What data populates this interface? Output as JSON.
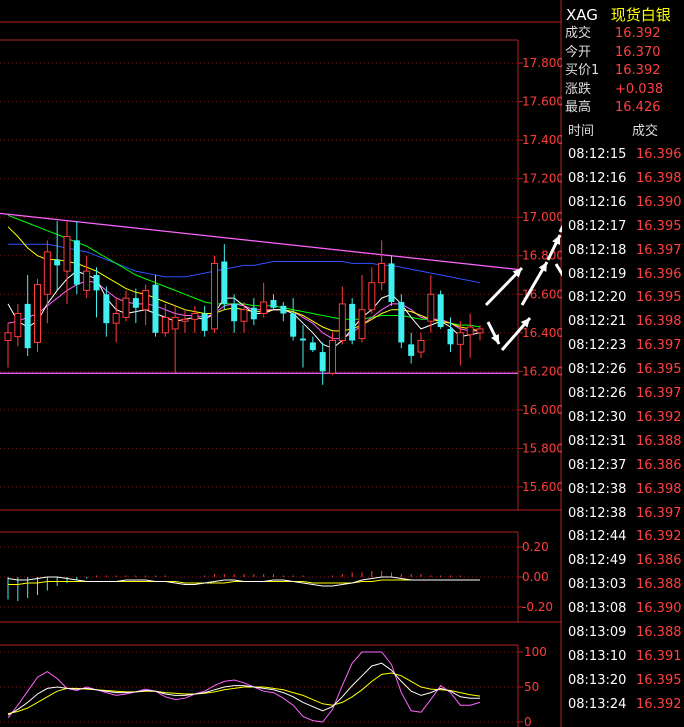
{
  "header": {
    "symbol": "XAG",
    "name": "现货白银"
  },
  "quote": [
    {
      "label": "成交",
      "value": "16.392"
    },
    {
      "label": "今开",
      "value": "16.370"
    },
    {
      "label": "买价1",
      "value": "16.392"
    },
    {
      "label": "涨跌",
      "value": "+0.038"
    },
    {
      "label": "最高",
      "value": "16.426"
    }
  ],
  "ticks_header": {
    "time": "时间",
    "price": "成交"
  },
  "ticks": [
    {
      "time": "08:12:15",
      "price": "16.396"
    },
    {
      "time": "08:12:16",
      "price": "16.398"
    },
    {
      "time": "08:12:16",
      "price": "16.390"
    },
    {
      "time": "08:12:17",
      "price": "16.395"
    },
    {
      "time": "08:12:18",
      "price": "16.397"
    },
    {
      "time": "08:12:19",
      "price": "16.396"
    },
    {
      "time": "08:12:20",
      "price": "16.395"
    },
    {
      "time": "08:12:21",
      "price": "16.398"
    },
    {
      "time": "08:12:23",
      "price": "16.397"
    },
    {
      "time": "08:12:26",
      "price": "16.395"
    },
    {
      "time": "08:12:26",
      "price": "16.397"
    },
    {
      "time": "08:12:30",
      "price": "16.392"
    },
    {
      "time": "08:12:31",
      "price": "16.388"
    },
    {
      "time": "08:12:37",
      "price": "16.386"
    },
    {
      "time": "08:12:38",
      "price": "16.398"
    },
    {
      "time": "08:12:38",
      "price": "16.397"
    },
    {
      "time": "08:12:44",
      "price": "16.392"
    },
    {
      "time": "08:12:49",
      "price": "16.386"
    },
    {
      "time": "08:13:03",
      "price": "16.388"
    },
    {
      "time": "08:13:08",
      "price": "16.390"
    },
    {
      "time": "08:13:09",
      "price": "16.388"
    },
    {
      "time": "08:13:10",
      "price": "16.391"
    },
    {
      "time": "08:13:20",
      "price": "16.395"
    },
    {
      "time": "08:13:24",
      "price": "16.392"
    }
  ],
  "colors": {
    "up": "#ff3c3c",
    "down": "#40f0f0",
    "axis": "#b02020",
    "trendline": "#ff66ff",
    "ma1": "#ffffff",
    "ma2": "#ffff00",
    "ma3": "#ff66ff",
    "ma4": "#00ff00",
    "ma5": "#3050ff"
  },
  "chart_data": [
    {
      "type": "candlestick",
      "ylim": [
        15.48,
        17.92
      ],
      "yticks": [
        "17.800",
        "17.600",
        "17.400",
        "17.200",
        "17.000",
        "16.800",
        "16.600",
        "16.400",
        "16.200",
        "16.000",
        "15.800",
        "15.600"
      ],
      "ytick_values": [
        17.8,
        17.6,
        17.4,
        17.2,
        17.0,
        16.8,
        16.6,
        16.4,
        16.2,
        16.0,
        15.8,
        15.6
      ],
      "candles": [
        {
          "o": 16.36,
          "h": 16.45,
          "l": 16.22,
          "c": 16.4
        },
        {
          "o": 16.38,
          "h": 16.55,
          "l": 16.33,
          "c": 16.5
        },
        {
          "o": 16.55,
          "h": 16.7,
          "l": 16.28,
          "c": 16.32
        },
        {
          "o": 16.35,
          "h": 16.68,
          "l": 16.3,
          "c": 16.65
        },
        {
          "o": 16.6,
          "h": 16.88,
          "l": 16.45,
          "c": 16.82
        },
        {
          "o": 16.78,
          "h": 16.98,
          "l": 16.62,
          "c": 16.75
        },
        {
          "o": 16.72,
          "h": 16.98,
          "l": 16.55,
          "c": 16.9
        },
        {
          "o": 16.88,
          "h": 16.98,
          "l": 16.6,
          "c": 16.65
        },
        {
          "o": 16.62,
          "h": 16.8,
          "l": 16.58,
          "c": 16.72
        },
        {
          "o": 16.7,
          "h": 16.74,
          "l": 16.48,
          "c": 16.62
        },
        {
          "o": 16.6,
          "h": 16.64,
          "l": 16.38,
          "c": 16.45
        },
        {
          "o": 16.45,
          "h": 16.58,
          "l": 16.35,
          "c": 16.5
        },
        {
          "o": 16.48,
          "h": 16.62,
          "l": 16.46,
          "c": 16.58
        },
        {
          "o": 16.58,
          "h": 16.63,
          "l": 16.45,
          "c": 16.53
        },
        {
          "o": 16.52,
          "h": 16.65,
          "l": 16.44,
          "c": 16.62
        },
        {
          "o": 16.65,
          "h": 16.7,
          "l": 16.38,
          "c": 16.4
        },
        {
          "o": 16.4,
          "h": 16.55,
          "l": 16.38,
          "c": 16.48
        },
        {
          "o": 16.42,
          "h": 16.54,
          "l": 16.19,
          "c": 16.48
        },
        {
          "o": 16.46,
          "h": 16.52,
          "l": 16.4,
          "c": 16.47
        },
        {
          "o": 16.47,
          "h": 16.54,
          "l": 16.4,
          "c": 16.5
        },
        {
          "o": 16.5,
          "h": 16.54,
          "l": 16.38,
          "c": 16.41
        },
        {
          "o": 16.42,
          "h": 16.8,
          "l": 16.4,
          "c": 16.76
        },
        {
          "o": 16.77,
          "h": 16.86,
          "l": 16.52,
          "c": 16.55
        },
        {
          "o": 16.55,
          "h": 16.6,
          "l": 16.4,
          "c": 16.46
        },
        {
          "o": 16.46,
          "h": 16.56,
          "l": 16.4,
          "c": 16.52
        },
        {
          "o": 16.53,
          "h": 16.58,
          "l": 16.44,
          "c": 16.47
        },
        {
          "o": 16.5,
          "h": 16.66,
          "l": 16.48,
          "c": 16.56
        },
        {
          "o": 16.57,
          "h": 16.6,
          "l": 16.52,
          "c": 16.53
        },
        {
          "o": 16.54,
          "h": 16.56,
          "l": 16.46,
          "c": 16.5
        },
        {
          "o": 16.5,
          "h": 16.58,
          "l": 16.36,
          "c": 16.38
        },
        {
          "o": 16.37,
          "h": 16.44,
          "l": 16.22,
          "c": 16.36
        },
        {
          "o": 16.35,
          "h": 16.38,
          "l": 16.3,
          "c": 16.31
        },
        {
          "o": 16.3,
          "h": 16.35,
          "l": 16.13,
          "c": 16.2
        },
        {
          "o": 16.19,
          "h": 16.4,
          "l": 16.18,
          "c": 16.36
        },
        {
          "o": 16.36,
          "h": 16.64,
          "l": 16.34,
          "c": 16.55
        },
        {
          "o": 16.55,
          "h": 16.58,
          "l": 16.34,
          "c": 16.36
        },
        {
          "o": 16.37,
          "h": 16.7,
          "l": 16.35,
          "c": 16.52
        },
        {
          "o": 16.52,
          "h": 16.74,
          "l": 16.5,
          "c": 16.66
        },
        {
          "o": 16.66,
          "h": 16.88,
          "l": 16.62,
          "c": 16.76
        },
        {
          "o": 16.76,
          "h": 16.8,
          "l": 16.54,
          "c": 16.56
        },
        {
          "o": 16.56,
          "h": 16.6,
          "l": 16.32,
          "c": 16.35
        },
        {
          "o": 16.34,
          "h": 16.4,
          "l": 16.24,
          "c": 16.28
        },
        {
          "o": 16.3,
          "h": 16.4,
          "l": 16.27,
          "c": 16.36
        },
        {
          "o": 16.46,
          "h": 16.7,
          "l": 16.4,
          "c": 16.6
        },
        {
          "o": 16.6,
          "h": 16.62,
          "l": 16.42,
          "c": 16.43
        },
        {
          "o": 16.42,
          "h": 16.48,
          "l": 16.3,
          "c": 16.34
        },
        {
          "o": 16.34,
          "h": 16.46,
          "l": 16.23,
          "c": 16.4
        },
        {
          "o": 16.39,
          "h": 16.5,
          "l": 16.27,
          "c": 16.43
        },
        {
          "o": 16.4,
          "h": 16.44,
          "l": 16.36,
          "c": 16.42
        }
      ],
      "ma_white": [
        16.55,
        16.46,
        16.43,
        16.46,
        16.55,
        16.62,
        16.68,
        16.72,
        16.7,
        16.68,
        16.58,
        16.52,
        16.5,
        16.51,
        16.52,
        16.5,
        16.48,
        16.46,
        16.47,
        16.48,
        16.47,
        16.5,
        16.58,
        16.58,
        16.54,
        16.5,
        16.5,
        16.52,
        16.52,
        16.5,
        16.45,
        16.4,
        16.34,
        16.32,
        16.36,
        16.42,
        16.48,
        16.52,
        16.58,
        16.6,
        16.55,
        16.48,
        16.42,
        16.44,
        16.46,
        16.43,
        16.38,
        16.39,
        16.4
      ],
      "ma_yellow": [
        16.95,
        16.9,
        16.84,
        16.8,
        16.78,
        16.78,
        16.77,
        16.76,
        16.74,
        16.72,
        16.69,
        16.66,
        16.63,
        16.61,
        16.6,
        16.58,
        16.56,
        16.54,
        16.52,
        16.51,
        16.5,
        16.5,
        16.52,
        16.53,
        16.52,
        16.51,
        16.51,
        16.52,
        16.52,
        16.51,
        16.49,
        16.46,
        16.43,
        16.41,
        16.41,
        16.42,
        16.44,
        16.47,
        16.5,
        16.52,
        16.52,
        16.51,
        16.49,
        16.47,
        16.46,
        16.45,
        16.43,
        16.42,
        16.41
      ],
      "ma_green": [
        17.01,
        16.99,
        16.97,
        16.95,
        16.93,
        16.91,
        16.89,
        16.87,
        16.85,
        16.82,
        16.79,
        16.76,
        16.73,
        16.7,
        16.68,
        16.66,
        16.64,
        16.62,
        16.6,
        16.58,
        16.56,
        16.55,
        16.55,
        16.55,
        16.55,
        16.54,
        16.54,
        16.54,
        16.53,
        16.52,
        16.51,
        16.5,
        16.49,
        16.48,
        16.47,
        16.47,
        16.47,
        16.48,
        16.49,
        16.49,
        16.49,
        16.48,
        16.47,
        16.47,
        16.46,
        16.45,
        16.44,
        16.44,
        16.43
      ],
      "ma_blue": [
        16.86,
        16.86,
        16.86,
        16.86,
        16.86,
        16.85,
        16.84,
        16.83,
        16.82,
        16.8,
        16.78,
        16.76,
        16.74,
        16.72,
        16.71,
        16.7,
        16.69,
        16.69,
        16.69,
        16.7,
        16.71,
        16.72,
        16.73,
        16.74,
        16.75,
        16.75,
        16.76,
        16.77,
        16.77,
        16.77,
        16.77,
        16.77,
        16.77,
        16.77,
        16.77,
        16.76,
        16.76,
        16.76,
        16.75,
        16.75,
        16.74,
        16.73,
        16.72,
        16.71,
        16.7,
        16.69,
        16.68,
        16.67,
        16.66
      ],
      "ma_pink": [
        16.45,
        16.46,
        16.48,
        16.5,
        16.54,
        16.58,
        16.62,
        16.65,
        16.67,
        16.66,
        16.62,
        16.58,
        16.56,
        16.55,
        16.55,
        16.54,
        16.52,
        16.5,
        16.49,
        16.49,
        16.48,
        16.5,
        16.54,
        16.55,
        16.54,
        16.52,
        16.52,
        16.52,
        16.52,
        16.51,
        16.48,
        16.45,
        16.4,
        16.37,
        16.37,
        16.4,
        16.44,
        16.48,
        16.52,
        16.55,
        16.55,
        16.52,
        16.48,
        16.47,
        16.47,
        16.45,
        16.42,
        16.41,
        16.41
      ],
      "trendline": [
        [
          0,
          17.02
        ],
        [
          48,
          16.75
        ]
      ],
      "support": 16.19,
      "annotation_arrows": true
    },
    {
      "type": "bar",
      "name": "MACD",
      "ylim": [
        -0.3,
        0.3
      ],
      "yticks": [
        "0.20",
        "0.00",
        "-0.20"
      ],
      "ytick_values": [
        0.2,
        0.0,
        -0.2
      ],
      "hist": [
        -0.15,
        -0.16,
        -0.14,
        -0.12,
        -0.09,
        -0.06,
        -0.04,
        -0.02,
        -0.01,
        0.01,
        0.01,
        0.01,
        0.01,
        0.01,
        0.01,
        0.01,
        0.01,
        0.0,
        0.0,
        0.0,
        0.01,
        0.02,
        0.02,
        0.02,
        0.02,
        0.02,
        0.02,
        0.02,
        0.01,
        0.01,
        0.01,
        0.0,
        0.0,
        0.01,
        0.02,
        0.03,
        0.03,
        0.04,
        0.04,
        0.03,
        0.02,
        0.02,
        0.02,
        0.01,
        0.01,
        0.01,
        0.01,
        0.0,
        0.0
      ],
      "line1": [
        -0.01,
        -0.02,
        -0.02,
        -0.01,
        0.0,
        0.0,
        -0.01,
        -0.02,
        -0.03,
        -0.03,
        -0.03,
        -0.03,
        -0.02,
        -0.02,
        -0.02,
        -0.03,
        -0.03,
        -0.04,
        -0.05,
        -0.05,
        -0.04,
        -0.03,
        -0.02,
        -0.02,
        -0.03,
        -0.03,
        -0.03,
        -0.02,
        -0.02,
        -0.03,
        -0.04,
        -0.05,
        -0.06,
        -0.06,
        -0.05,
        -0.04,
        -0.02,
        -0.01,
        0.0,
        0.0,
        -0.01,
        -0.02,
        -0.02,
        -0.02,
        -0.02,
        -0.02,
        -0.02,
        -0.02,
        -0.02
      ],
      "line2": [
        -0.05,
        -0.05,
        -0.04,
        -0.04,
        -0.03,
        -0.03,
        -0.03,
        -0.03,
        -0.03,
        -0.03,
        -0.03,
        -0.03,
        -0.03,
        -0.03,
        -0.03,
        -0.03,
        -0.03,
        -0.03,
        -0.04,
        -0.04,
        -0.04,
        -0.04,
        -0.04,
        -0.03,
        -0.03,
        -0.03,
        -0.03,
        -0.03,
        -0.03,
        -0.03,
        -0.03,
        -0.04,
        -0.04,
        -0.04,
        -0.04,
        -0.04,
        -0.03,
        -0.03,
        -0.02,
        -0.02,
        -0.02,
        -0.02,
        -0.02,
        -0.02,
        -0.02,
        -0.02,
        -0.02,
        -0.02,
        -0.02
      ]
    },
    {
      "type": "line",
      "name": "KDJ",
      "ylim": [
        0,
        110
      ],
      "yticks": [
        "100",
        "50",
        "0"
      ],
      "ytick_values": [
        100,
        50,
        0
      ],
      "k": [
        10,
        18,
        28,
        40,
        48,
        50,
        48,
        47,
        48,
        46,
        44,
        42,
        42,
        43,
        45,
        44,
        40,
        38,
        38,
        40,
        42,
        46,
        50,
        52,
        52,
        50,
        48,
        46,
        42,
        36,
        28,
        22,
        16,
        22,
        36,
        52,
        66,
        80,
        84,
        74,
        58,
        44,
        38,
        42,
        48,
        44,
        36,
        34,
        34
      ],
      "d": [
        12,
        15,
        20,
        28,
        36,
        44,
        48,
        48,
        47,
        46,
        45,
        44,
        43,
        43,
        44,
        44,
        42,
        41,
        40,
        40,
        41,
        43,
        46,
        48,
        50,
        50,
        50,
        48,
        46,
        42,
        38,
        32,
        26,
        24,
        28,
        36,
        46,
        58,
        68,
        70,
        66,
        58,
        50,
        47,
        46,
        45,
        42,
        39,
        37
      ],
      "j": [
        6,
        24,
        44,
        64,
        72,
        62,
        48,
        45,
        50,
        46,
        42,
        38,
        40,
        43,
        47,
        44,
        36,
        32,
        34,
        40,
        44,
        52,
        58,
        60,
        56,
        50,
        44,
        42,
        34,
        24,
        8,
        2,
        0,
        18,
        52,
        84,
        100,
        100,
        100,
        82,
        42,
        16,
        14,
        32,
        52,
        42,
        24,
        24,
        28
      ]
    }
  ]
}
